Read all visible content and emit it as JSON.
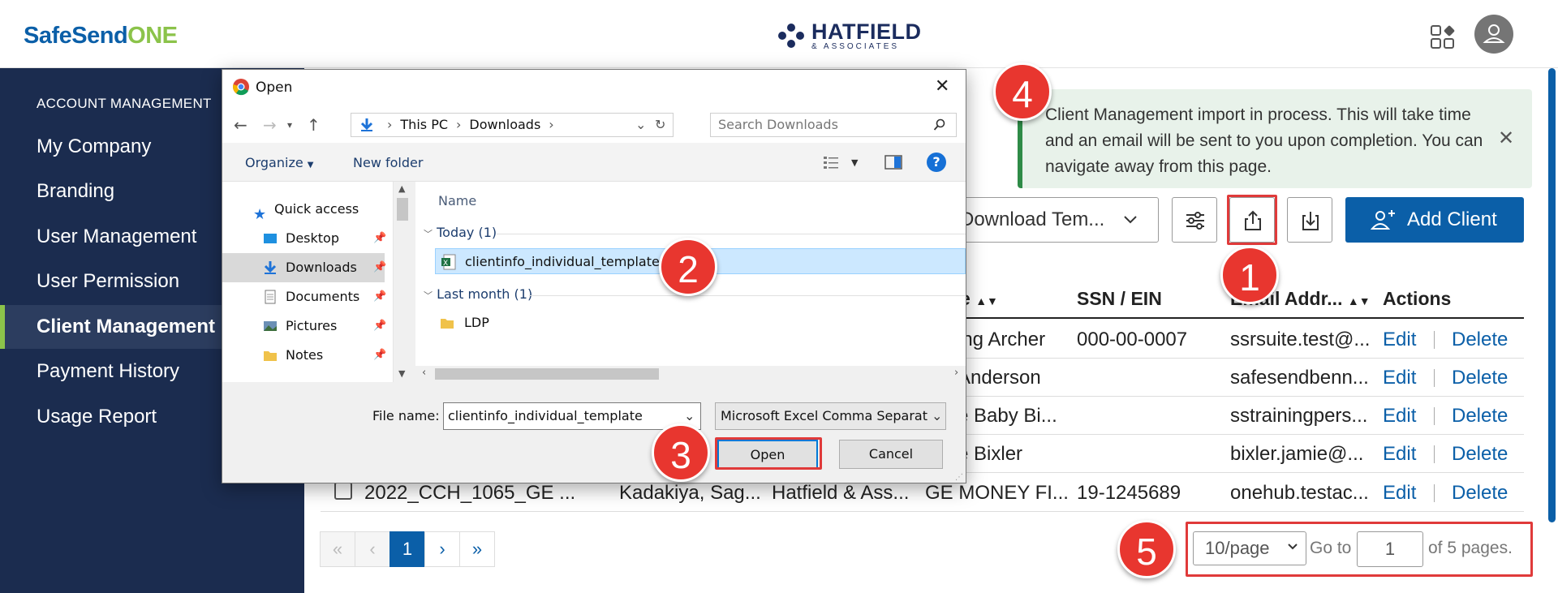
{
  "header": {
    "brand_part1": "SafeSend",
    "brand_part2": "ONE",
    "org_logo_name": "HATFIELD",
    "org_logo_sub": "& ASSOCIATES"
  },
  "sidebar": {
    "heading": "ACCOUNT MANAGEMENT",
    "items": [
      {
        "label": "My Company"
      },
      {
        "label": "Branding"
      },
      {
        "label": "User Management"
      },
      {
        "label": "User Permission"
      },
      {
        "label": "Client Management",
        "active": true
      },
      {
        "label": "Payment History"
      },
      {
        "label": "Usage Report"
      }
    ]
  },
  "toast": {
    "message": "Client Management import in process. This will take time and an email will be sent to you upon completion. You can navigate away from this page.",
    "close_glyph": "✕"
  },
  "toolbar": {
    "download_template_label": "Download Tem...",
    "add_client_label": "Add Client"
  },
  "table": {
    "headers": {
      "name_partial": "e",
      "ssn": "SSN / EIN",
      "email": "Email Addr...",
      "actions": "Actions"
    },
    "rows": [
      {
        "name": "ing Archer",
        "ssn": "000-00-0007",
        "email": "ssrsuite.test@...",
        "edit": "Edit",
        "delete": "Delete"
      },
      {
        "name": "Anderson",
        "ssn": "",
        "email": "safesendbenn...",
        "edit": "Edit",
        "delete": "Delete"
      },
      {
        "name": "e Baby Bi...",
        "ssn": "",
        "email": "sstrainingpers...",
        "edit": "Edit",
        "delete": "Delete"
      },
      {
        "name": "e Bixler",
        "ssn": "",
        "email": "bixler.jamie@...",
        "edit": "Edit",
        "delete": "Delete"
      },
      {
        "id": "2022_CCH_1065_GE ...",
        "col2": "Kadakiya, Sag...",
        "col3": "Hatfield & Ass...",
        "name": "GE MONEY FI...",
        "ssn": "19-1245689",
        "email": "onehub.testac...",
        "edit": "Edit",
        "delete": "Delete"
      }
    ]
  },
  "pagination": {
    "current_page": "1",
    "per_page": "10/page",
    "goto_label": "Go to",
    "goto_value": "1",
    "suffix": "of 5 pages."
  },
  "dialog": {
    "title": "Open",
    "close_glyph": "✕",
    "path": [
      "This PC",
      "Downloads"
    ],
    "search_placeholder": "Search Downloads",
    "organize_label": "Organize",
    "new_folder_label": "New folder",
    "help_glyph": "?",
    "nav_items": [
      {
        "label": "Quick access"
      },
      {
        "label": "Desktop"
      },
      {
        "label": "Downloads",
        "selected": true
      },
      {
        "label": "Documents"
      },
      {
        "label": "Pictures"
      },
      {
        "label": "Notes"
      }
    ],
    "column_name": "Name",
    "groups": [
      {
        "label": "Today (1)",
        "files": [
          {
            "name": "clientinfo_individual_template",
            "selected": true
          }
        ]
      },
      {
        "label": "Last month (1)",
        "files": [
          {
            "name": "LDP"
          }
        ]
      }
    ],
    "file_name_label": "File name:",
    "file_name_value": "clientinfo_individual_template",
    "file_type_value": "Microsoft Excel Comma Separat",
    "open_label": "Open",
    "cancel_label": "Cancel"
  },
  "annotations": [
    "1",
    "2",
    "3",
    "4",
    "5"
  ],
  "colors": {
    "accent_red": "#e8362f",
    "brand_blue": "#0b5fa8",
    "brand_green": "#8bc34a",
    "sidebar_bg": "#1b2c4f"
  }
}
